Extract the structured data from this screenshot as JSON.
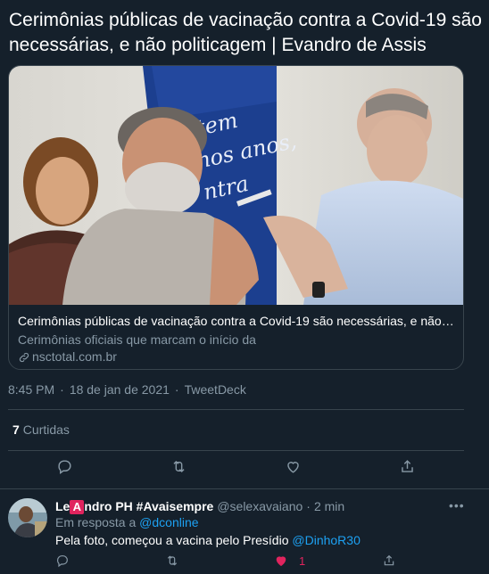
{
  "tweet": {
    "text": "Cerimônias públicas de vacinação contra a Covid-19 são necessárias, e não politicagem | Evandro de Assis",
    "card": {
      "title": "Cerimônias públicas de vacinação contra a Covid-19 são necessárias, e não po...",
      "description": "Cerimônias oficiais que marcam o início da",
      "domain": "nsctotal.com.br",
      "image_poster_text": [
        "tem",
        "nos anos,",
        "ntra"
      ]
    },
    "time": "8:45 PM",
    "date": "18 de jan de 2021",
    "source": "TweetDeck",
    "likes_count": "7",
    "likes_label": "Curtidas"
  },
  "reply": {
    "name_prefix": "Le",
    "name_badge": "A",
    "name_suffix": "ndro PH #Avaisempre",
    "handle": "@selexavaiano",
    "time": "2 min",
    "reply_to_label": "Em resposta a",
    "reply_to_handle": "@dconline",
    "text": "Pela foto, começou a vacina pelo Presídio",
    "mention": "@DinhoR30",
    "like_count": "1"
  },
  "colors": {
    "background": "#15202b",
    "border": "#38444d",
    "secondary_text": "#8899a6",
    "link": "#1da1f2",
    "like_active": "#e0245e"
  },
  "icons": [
    "reply-icon",
    "retweet-icon",
    "like-icon",
    "share-icon",
    "link-icon",
    "more-icon"
  ]
}
